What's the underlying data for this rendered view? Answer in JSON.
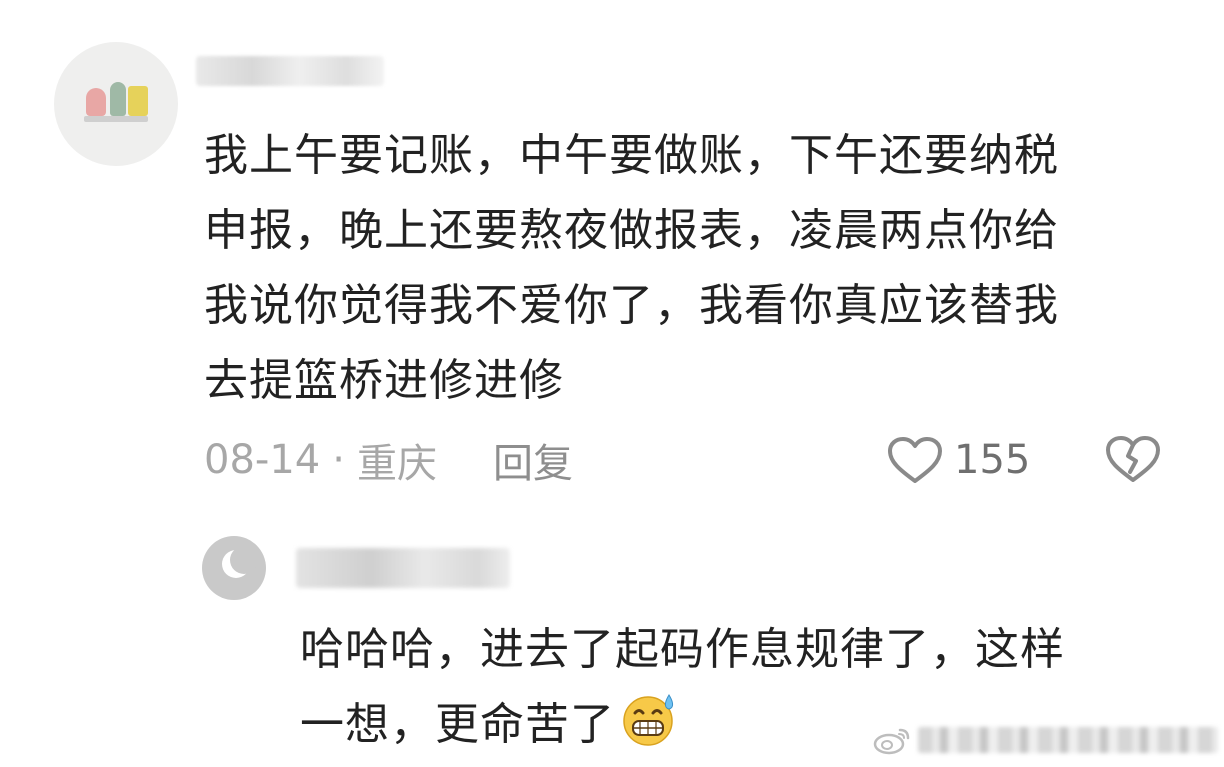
{
  "comment": {
    "text": "我上午要记账，中午要做账，下午还要纳税\n申报，晚上还要熬夜做报表，凌晨两点你给\n我说你觉得我不爱你了，我看你真应该替我\n去提篮桥进修进修",
    "date": "08-14",
    "separator": "·",
    "location": "重庆",
    "reply_label": "回复",
    "like_count": "155",
    "like_icon": "heart-outline-icon",
    "dislike_icon": "broken-heart-icon"
  },
  "reply": {
    "text": "哈哈哈，进去了起码作息规律了，这样\n一想，更命苦了",
    "emoji": "grinning-sweat-emoji"
  },
  "colors": {
    "text_primary": "#222222",
    "text_meta": "#a7a7a7",
    "icon_gray": "#8a8a8a",
    "background": "#ffffff"
  }
}
